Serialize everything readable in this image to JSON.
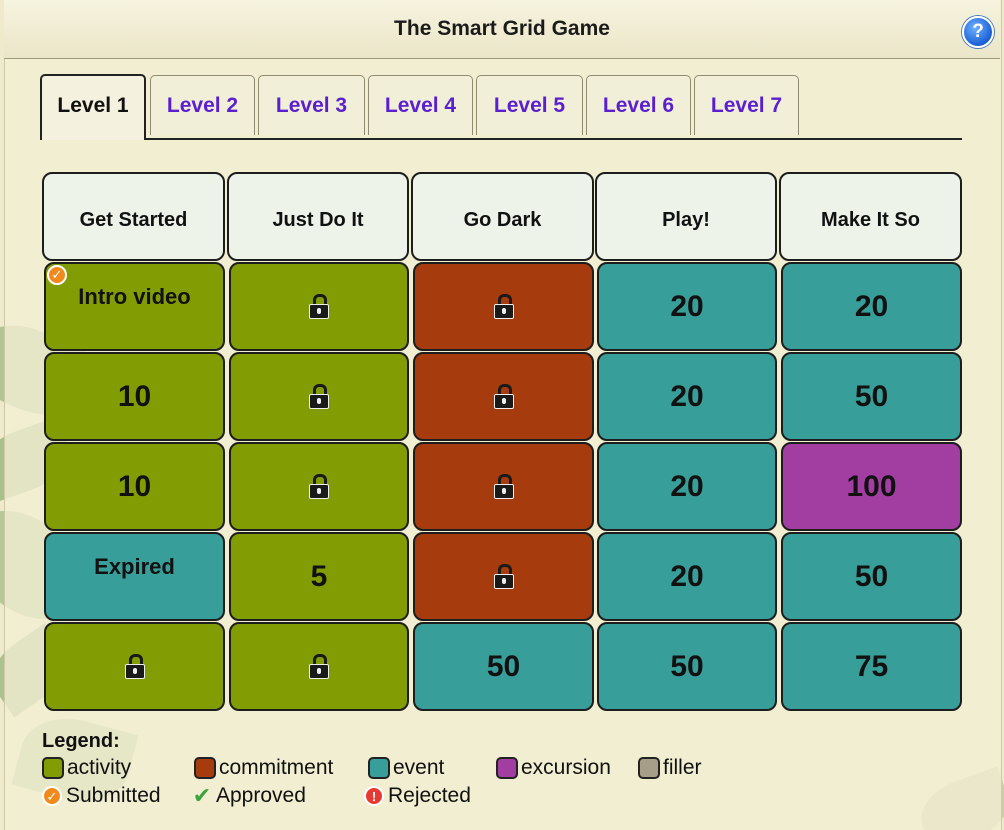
{
  "window": {
    "title": "The Smart Grid Game",
    "help_label": "?"
  },
  "tabs": [
    "Level 1",
    "Level 2",
    "Level 3",
    "Level 4",
    "Level 5",
    "Level 6",
    "Level 7"
  ],
  "active_tab": 0,
  "columns": [
    "Get Started",
    "Just Do It",
    "Go Dark",
    "Play!",
    "Make It So"
  ],
  "colors": {
    "activity": "#829d03",
    "commitment": "#a63b0d",
    "event": "#379e99",
    "excursion": "#a23ea2",
    "filler": "#a79e8a"
  },
  "grid": [
    [
      {
        "type": "activity",
        "text": "Intro video",
        "status": "submitted"
      },
      {
        "type": "activity",
        "locked": true
      },
      {
        "type": "commitment",
        "locked": true
      },
      {
        "type": "event",
        "text": "20"
      },
      {
        "type": "event",
        "text": "20"
      }
    ],
    [
      {
        "type": "activity",
        "text": "10"
      },
      {
        "type": "activity",
        "locked": true
      },
      {
        "type": "commitment",
        "locked": true
      },
      {
        "type": "event",
        "text": "20"
      },
      {
        "type": "event",
        "text": "50"
      }
    ],
    [
      {
        "type": "activity",
        "text": "10"
      },
      {
        "type": "activity",
        "locked": true
      },
      {
        "type": "commitment",
        "locked": true
      },
      {
        "type": "event",
        "text": "20"
      },
      {
        "type": "excursion",
        "text": "100"
      }
    ],
    [
      {
        "type": "event",
        "text": "Expired"
      },
      {
        "type": "activity",
        "text": "5"
      },
      {
        "type": "commitment",
        "locked": true
      },
      {
        "type": "event",
        "text": "20"
      },
      {
        "type": "event",
        "text": "50"
      }
    ],
    [
      {
        "type": "activity",
        "locked": true
      },
      {
        "type": "activity",
        "locked": true
      },
      {
        "type": "event",
        "text": "50"
      },
      {
        "type": "event",
        "text": "50"
      },
      {
        "type": "event",
        "text": "75"
      }
    ]
  ],
  "legend": {
    "title": "Legend:",
    "types": [
      {
        "key": "activity",
        "label": "activity"
      },
      {
        "key": "commitment",
        "label": "commitment"
      },
      {
        "key": "event",
        "label": "event"
      },
      {
        "key": "excursion",
        "label": "excursion"
      },
      {
        "key": "filler",
        "label": "filler"
      }
    ],
    "statuses": [
      {
        "key": "submitted",
        "label": "Submitted",
        "icon": "submitted-icon"
      },
      {
        "key": "approved",
        "label": "Approved",
        "icon": "approved-check-icon"
      },
      {
        "key": "rejected",
        "label": "Rejected",
        "icon": "rejected-icon"
      }
    ]
  }
}
